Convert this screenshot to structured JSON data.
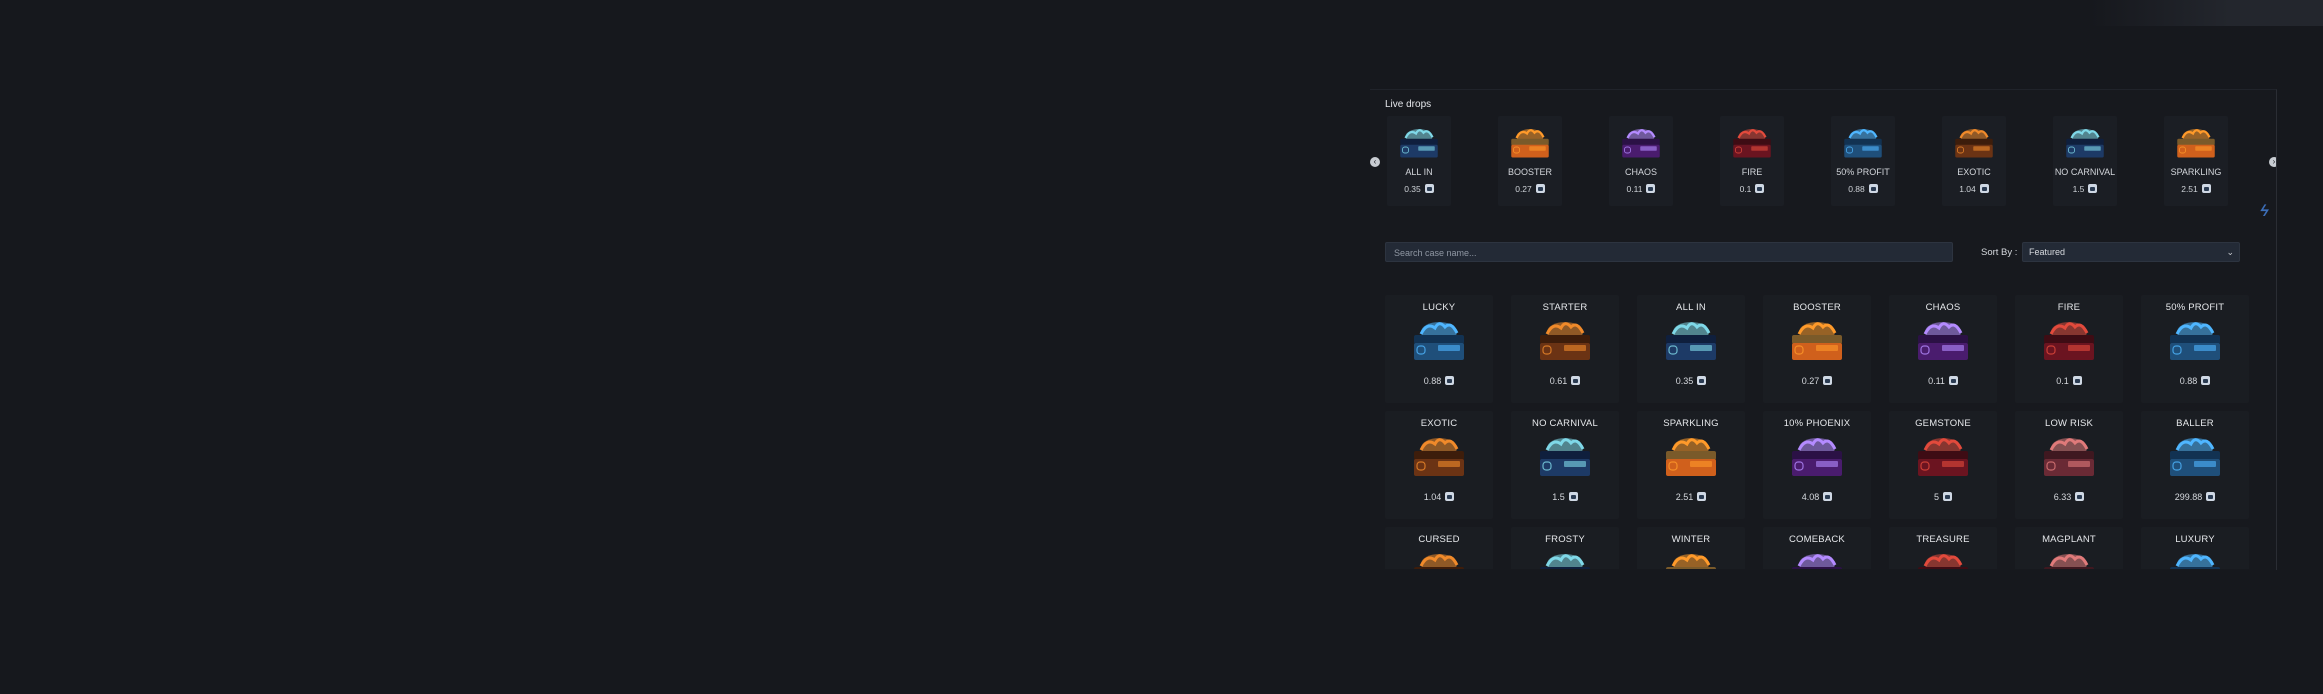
{
  "live_drops": {
    "title": "Live drops",
    "items": [
      {
        "name": "ALL IN",
        "price": "0.35",
        "theme": "blue"
      },
      {
        "name": "BOOSTER",
        "price": "0.27",
        "theme": "orange"
      },
      {
        "name": "CHAOS",
        "price": "0.11",
        "theme": "purple"
      },
      {
        "name": "FIRE",
        "price": "0.1",
        "theme": "red"
      },
      {
        "name": "50% PROFIT",
        "price": "0.88",
        "theme": "teal"
      },
      {
        "name": "EXOTIC",
        "price": "1.04",
        "theme": "brown"
      },
      {
        "name": "NO CARNIVAL",
        "price": "1.5",
        "theme": "blue"
      },
      {
        "name": "SPARKLING",
        "price": "2.51",
        "theme": "orange"
      }
    ]
  },
  "search": {
    "placeholder": "Search case name..."
  },
  "sort": {
    "label": "Sort By :",
    "value": "Featured"
  },
  "cases": [
    {
      "name": "LUCKY",
      "price": "0.88",
      "theme": "teal"
    },
    {
      "name": "STARTER",
      "price": "0.61",
      "theme": "brown"
    },
    {
      "name": "ALL IN",
      "price": "0.35",
      "theme": "blue"
    },
    {
      "name": "BOOSTER",
      "price": "0.27",
      "theme": "orange"
    },
    {
      "name": "CHAOS",
      "price": "0.11",
      "theme": "purple"
    },
    {
      "name": "FIRE",
      "price": "0.1",
      "theme": "red"
    },
    {
      "name": "50% PROFIT",
      "price": "0.88",
      "theme": "teal"
    },
    {
      "name": "EXOTIC",
      "price": "1.04",
      "theme": "brown"
    },
    {
      "name": "NO CARNIVAL",
      "price": "1.5",
      "theme": "blue"
    },
    {
      "name": "SPARKLING",
      "price": "2.51",
      "theme": "orange"
    },
    {
      "name": "10% PHOENIX",
      "price": "4.08",
      "theme": "purple"
    },
    {
      "name": "GEMSTONE",
      "price": "5",
      "theme": "red"
    },
    {
      "name": "LOW RISK",
      "price": "6.33",
      "theme": "rose"
    },
    {
      "name": "BALLER",
      "price": "299.88",
      "theme": "teal"
    },
    {
      "name": "CURSED",
      "price": "",
      "theme": "brown"
    },
    {
      "name": "FROSTY",
      "price": "",
      "theme": "blue"
    },
    {
      "name": "WINTER",
      "price": "",
      "theme": "orange"
    },
    {
      "name": "COMEBACK",
      "price": "",
      "theme": "purple"
    },
    {
      "name": "TREASURE",
      "price": "",
      "theme": "red"
    },
    {
      "name": "MAGPLANT",
      "price": "",
      "theme": "rose"
    },
    {
      "name": "LUXURY",
      "price": "",
      "theme": "teal"
    }
  ],
  "themes": {
    "blue": {
      "body": "#1d3a66",
      "lid": "#0f1f3d",
      "glow": "#7fd8e8"
    },
    "orange": {
      "body": "#d0601c",
      "lid": "#7a5a2a",
      "glow": "#ff9a2a"
    },
    "purple": {
      "body": "#4a1c6e",
      "lid": "#2b1145",
      "glow": "#b48bff"
    },
    "red": {
      "body": "#6b1420",
      "lid": "#3e0c14",
      "glow": "#e24a3c"
    },
    "teal": {
      "body": "#1f4f7a",
      "lid": "#123252",
      "glow": "#4fb6ff"
    },
    "brown": {
      "body": "#6b3314",
      "lid": "#3d1d0b",
      "glow": "#f08a2a"
    },
    "rose": {
      "body": "#6a2a35",
      "lid": "#3f1820",
      "glow": "#e07a7a"
    }
  },
  "icons": {
    "left_arrow": "chevron-left-icon",
    "right_arrow": "chevron-right-icon",
    "coin": "coin-icon",
    "brand": "bolt-logo-icon",
    "select": "chevron-down-icon"
  }
}
